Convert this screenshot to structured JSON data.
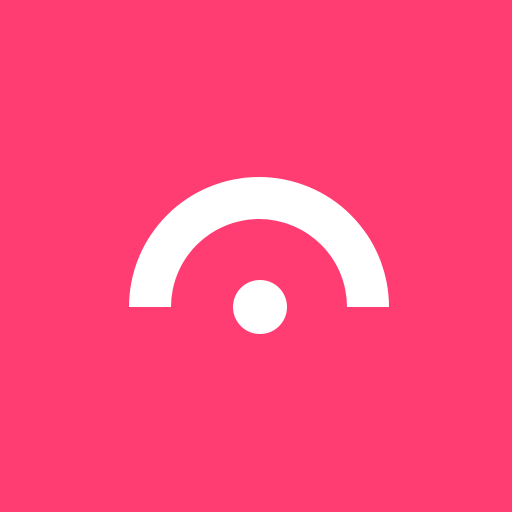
{
  "logo": {
    "icon_name": "half-ring-with-dot-icon",
    "background_color": "#ff3d73",
    "mark_color": "#ffffff"
  }
}
